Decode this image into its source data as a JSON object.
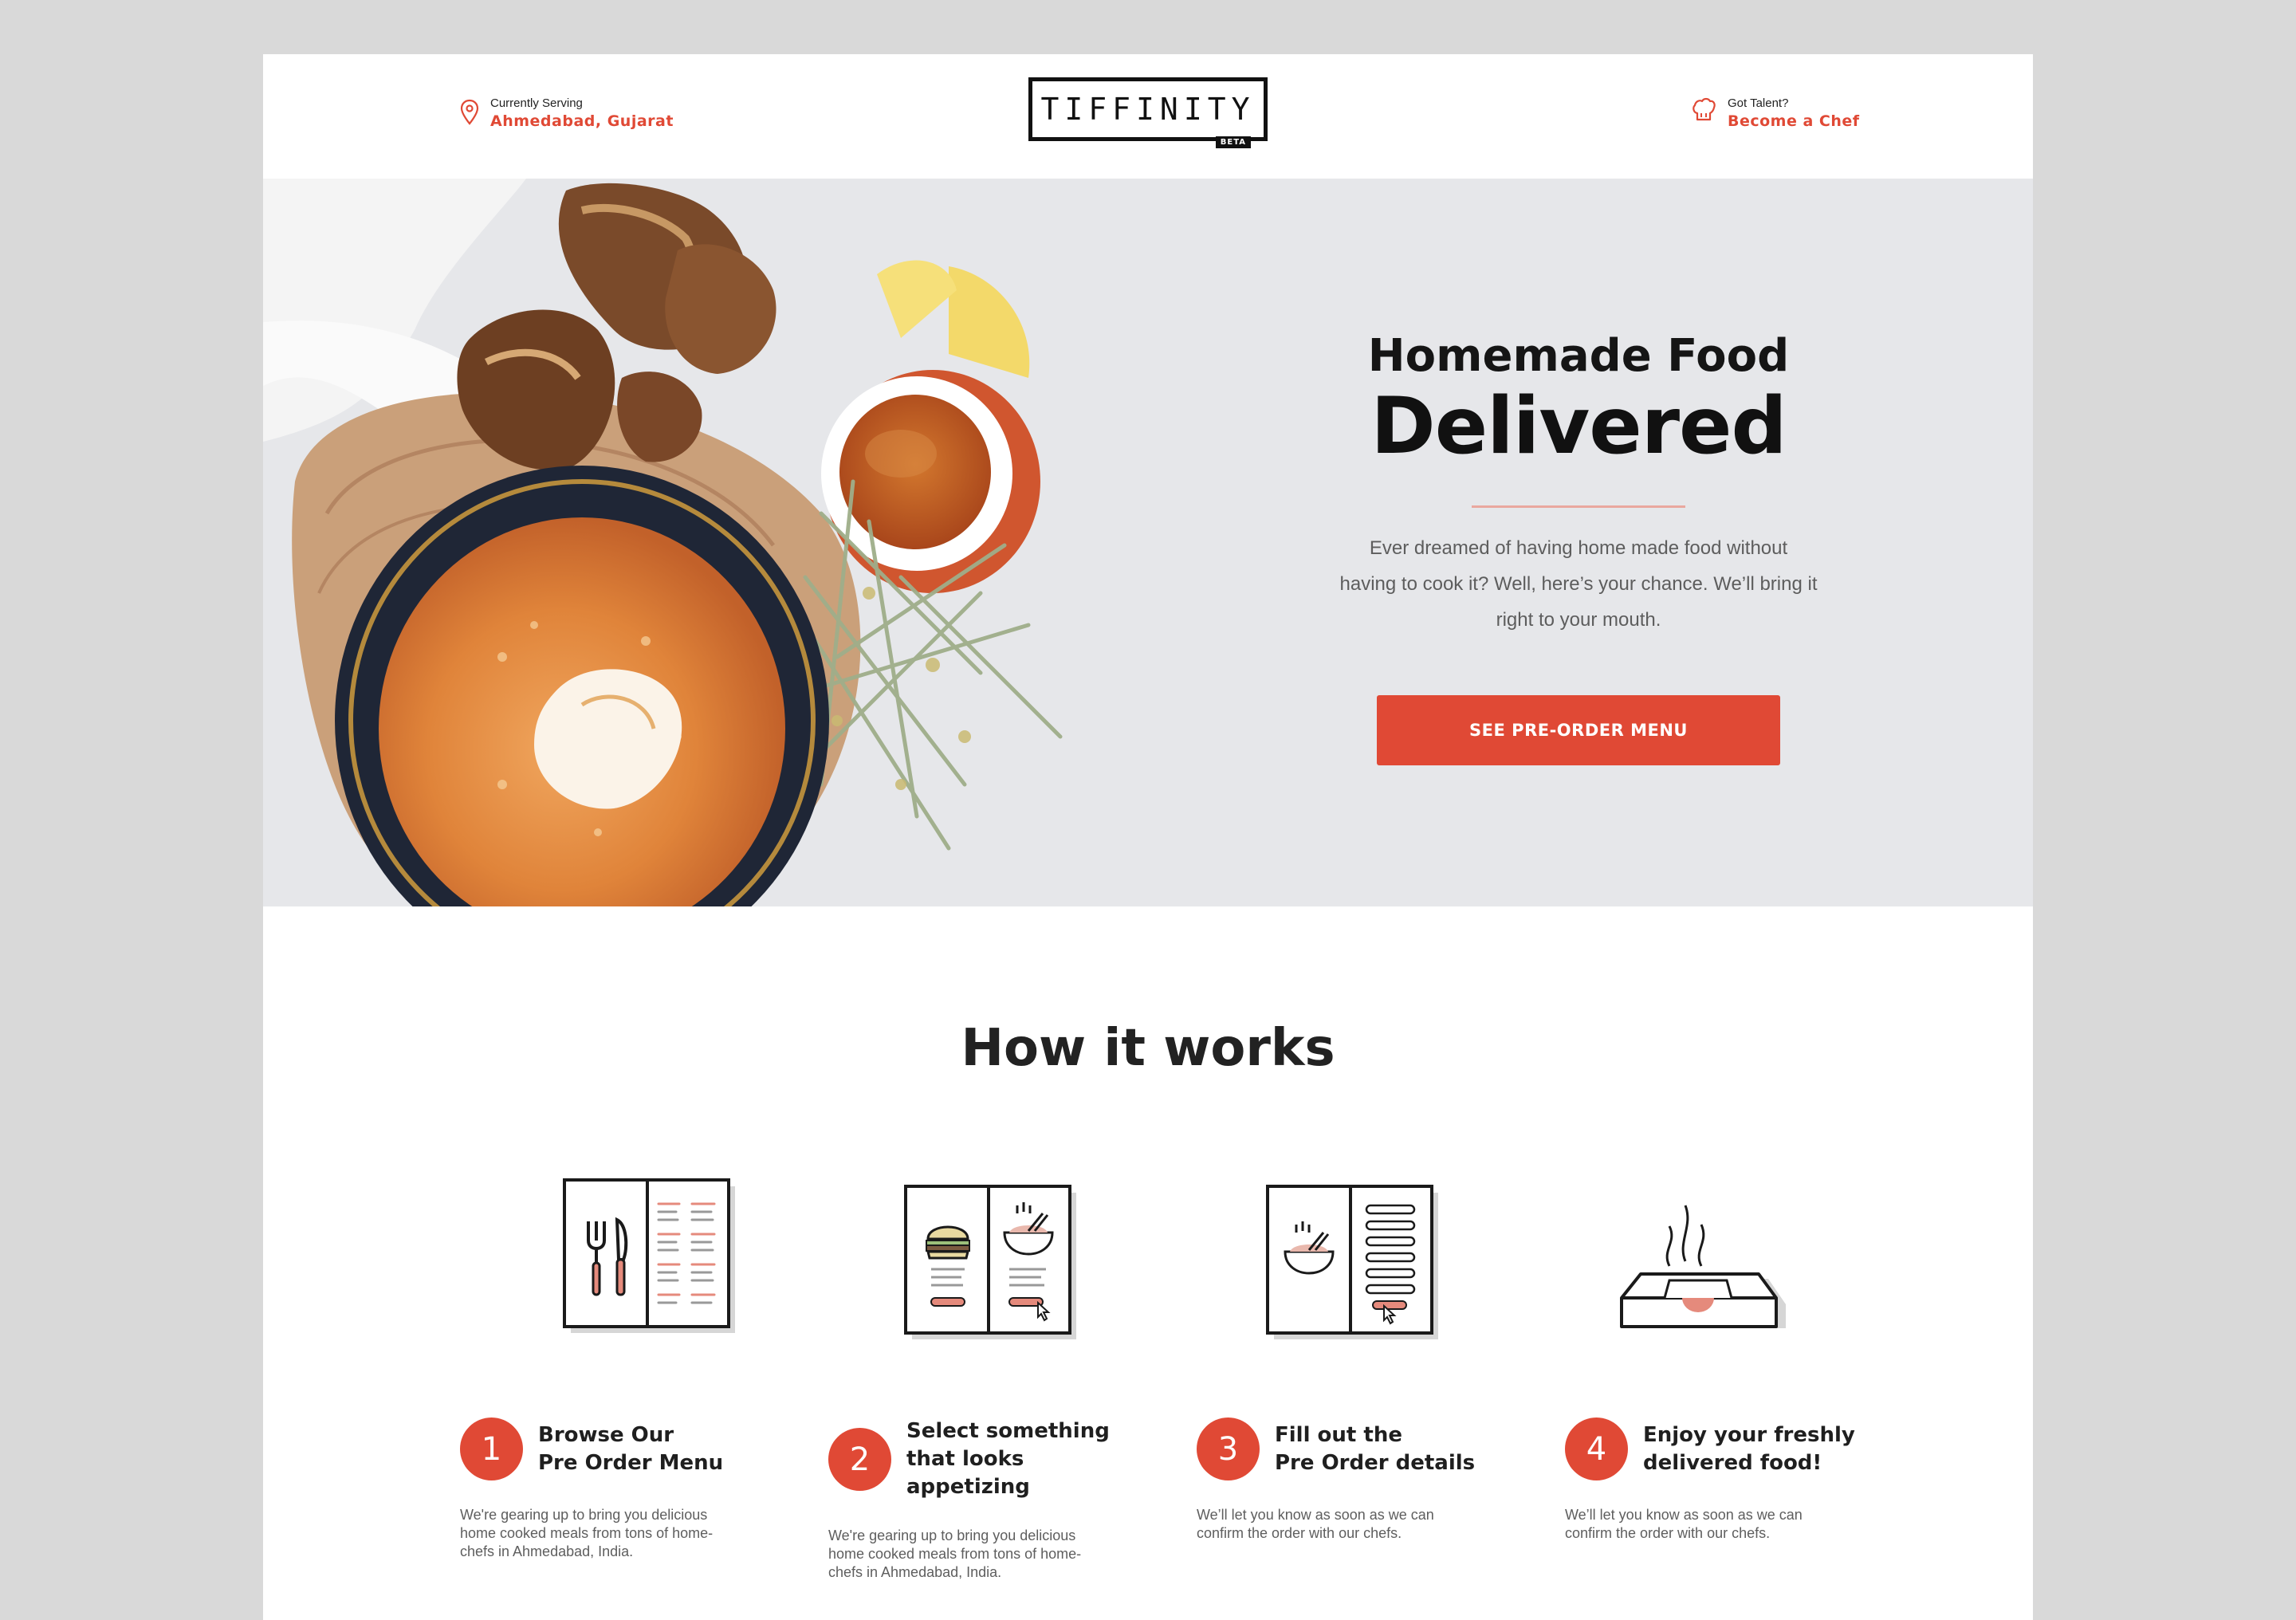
{
  "header": {
    "location_label": "Currently Serving",
    "location_value": "Ahmedabad, Gujarat",
    "logo_text": "TIFFINITY",
    "logo_badge": "BETA",
    "chef_label": "Got Talent?",
    "chef_link": "Become a Chef"
  },
  "hero": {
    "title_small": "Homemade Food",
    "title_big": "Delivered",
    "description": "Ever dreamed of having home made food without having to cook it? Well, here’s your chance. We’ll bring it right to your mouth.",
    "cta_label": "SEE PRE-ORDER MENU"
  },
  "how": {
    "title": "How it works",
    "steps": [
      {
        "number": "1",
        "title_line1": "Browse Our",
        "title_line2": "Pre Order Menu",
        "description": "We're gearing up to bring you delicious home cooked meals from tons of home-chefs in Ahmedabad, India.",
        "icon": "menu-book-icon"
      },
      {
        "number": "2",
        "title_line1": "Select something",
        "title_line2": "that looks appetizing",
        "description": "We're gearing up to bring you delicious home cooked meals from tons of home-chefs in Ahmedabad, India.",
        "icon": "select-dish-icon"
      },
      {
        "number": "3",
        "title_line1": "Fill out the",
        "title_line2": "Pre Order details",
        "description": "We’ll let you know as soon as we can confirm the order with our chefs.",
        "icon": "order-form-icon"
      },
      {
        "number": "4",
        "title_line1": "Enjoy your freshly",
        "title_line2": "delivered food!",
        "description": "We’ll let you know as soon as we can confirm the order with our chefs.",
        "icon": "food-box-icon"
      }
    ]
  },
  "colors": {
    "accent": "#e04935",
    "hero_bg": "#e6e7ea",
    "outer_bg": "#d9d9d9"
  }
}
